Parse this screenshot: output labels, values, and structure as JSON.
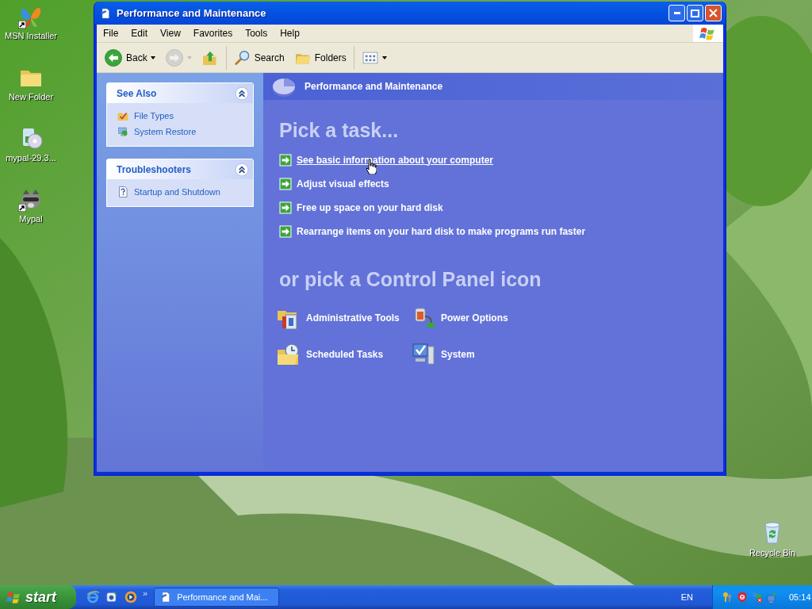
{
  "desktop_icons": [
    {
      "kind": "butterfly",
      "label": "MSN Installer",
      "shortcut": true
    },
    {
      "kind": "folder",
      "label": "New Folder",
      "shortcut": false
    },
    {
      "kind": "disc",
      "label": "mypal-29.3...",
      "shortcut": false
    },
    {
      "kind": "animal",
      "label": "Mypal",
      "shortcut": true
    }
  ],
  "recycle_bin": {
    "label": "Recycle Bin"
  },
  "window": {
    "title": "Performance and Maintenance",
    "menu": [
      "File",
      "Edit",
      "View",
      "Favorites",
      "Tools",
      "Help"
    ],
    "toolbar": [
      {
        "kind": "back",
        "label": "Back",
        "disabled": false
      },
      {
        "kind": "forward",
        "disabled": true
      },
      {
        "kind": "up",
        "disabled": false
      },
      {
        "kind": "search",
        "label": "Search",
        "disabled": false
      },
      {
        "kind": "folders",
        "label": "Folders",
        "disabled": false
      },
      {
        "kind": "views",
        "disabled": false
      }
    ],
    "sidebar": [
      {
        "title": "See Also",
        "expanded": true,
        "items": [
          {
            "kind": "filetypes",
            "label": "File Types"
          },
          {
            "kind": "restore",
            "label": "System Restore"
          }
        ]
      },
      {
        "title": "Troubleshooters",
        "expanded": true,
        "items": [
          {
            "kind": "help",
            "label": "Startup and Shutdown"
          }
        ]
      }
    ],
    "header": "Performance and Maintenance",
    "task_heading": "Pick a task...",
    "tasks": [
      {
        "label": "See basic information about your computer",
        "hovered": true
      },
      {
        "label": "Adjust visual effects",
        "hovered": false
      },
      {
        "label": "Free up space on your hard disk",
        "hovered": false
      },
      {
        "label": "Rearrange items on your hard disk to make programs run faster",
        "hovered": false
      }
    ],
    "icon_heading": "or pick a Control Panel icon",
    "control_panel_icons": [
      {
        "kind": "admin",
        "label": "Administrative Tools"
      },
      {
        "kind": "power",
        "label": "Power Options"
      },
      {
        "kind": "scheduled",
        "label": "Scheduled Tasks"
      },
      {
        "kind": "system",
        "label": "System"
      }
    ]
  },
  "taskbar": {
    "start": "start",
    "quick_launch": [
      {
        "kind": "browser"
      },
      {
        "kind": "mail"
      },
      {
        "kind": "media"
      }
    ],
    "more": "»",
    "tasks": [
      {
        "label": "Performance and Mai..."
      }
    ],
    "language": "EN",
    "tray": [
      {
        "kind": "keys"
      },
      {
        "kind": "shield"
      },
      {
        "kind": "network"
      },
      {
        "kind": "monitor"
      }
    ],
    "clock": "05:14"
  }
}
